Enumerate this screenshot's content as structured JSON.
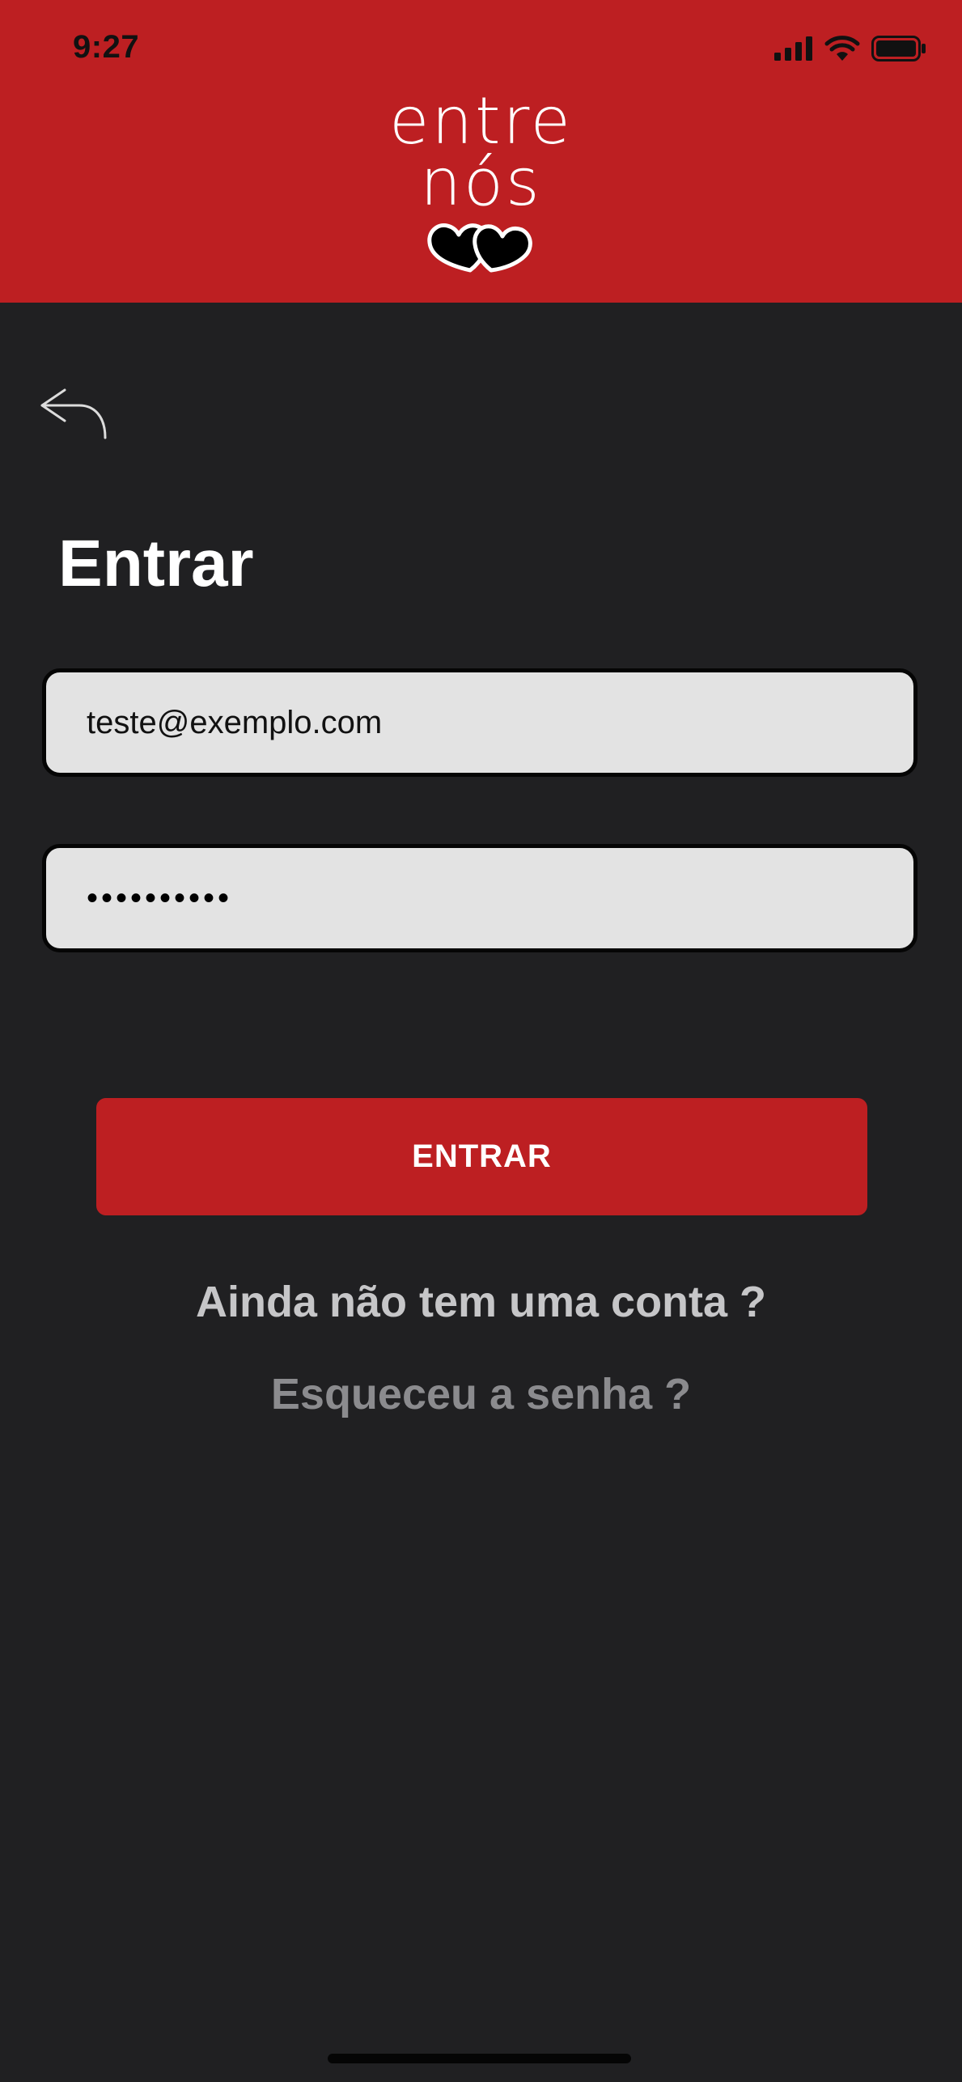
{
  "status_bar": {
    "time": "9:27"
  },
  "header": {
    "logo_line1": "entre",
    "logo_line2": "nós",
    "logo_icon": "two-hearts-icon",
    "background_color": "#bd1f22"
  },
  "nav": {
    "back_icon": "back-arrow-icon"
  },
  "login": {
    "title": "Entrar",
    "email_value": "teste@exemplo.com",
    "password_value": "••••••••••",
    "submit_label": "ENTRAR",
    "signup_link": "Ainda não tem uma conta ?",
    "forgot_link": "Esqueceu a senha ?"
  },
  "colors": {
    "accent": "#bd1f22",
    "background": "#202022",
    "input_background": "#e3e3e3"
  }
}
